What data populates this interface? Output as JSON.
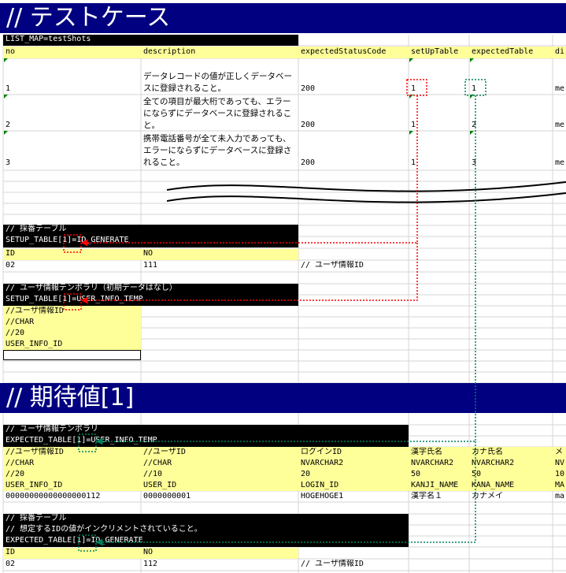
{
  "section1": {
    "title": "// テストケース"
  },
  "list_map": "LIST_MAP=testShots",
  "testcases": {
    "headers": [
      "no",
      "description",
      "expectedStatusCode",
      "setUpTable",
      "expectedTable",
      "di"
    ],
    "rows": [
      {
        "no": "1",
        "desc": "データレコードの値が正しくデータベースに登録されること。",
        "status": "200",
        "setup": "1",
        "expected": "1",
        "di": "me"
      },
      {
        "no": "2",
        "desc": "全ての項目が最大桁であっても、エラーにならずにデータベースに登録されること。",
        "status": "200",
        "setup": "1",
        "expected": "2",
        "di": "me"
      },
      {
        "no": "3",
        "desc": "携帯電話番号が全て未入力であっても、エラーにならずにデータベースに登録されること。",
        "status": "200",
        "setup": "1",
        "expected": "3",
        "di": "me"
      }
    ]
  },
  "setup1": {
    "comment": "// 採番テーブル",
    "name_prefix": "SETUP_TABLE",
    "name_index": "[1]",
    "name_suffix": "=ID_GENERATE",
    "col1_header": "ID",
    "col2_header": "NO",
    "col1_value": "02",
    "col2_value": "111",
    "note": "// ユーザ情報ID"
  },
  "setup2": {
    "comment": "// ユーザ情報テンポラリ（初期データはなし）",
    "name_prefix": "SETUP_TABLE",
    "name_index": "[1]",
    "name_suffix": "=USER_INFO_TEMP",
    "rows": [
      "//ユーザ情報ID",
      "//CHAR",
      "//20",
      "USER_INFO_ID"
    ]
  },
  "section2": {
    "title": "// 期待値[1]"
  },
  "expected1": {
    "comment": "// ユーザ情報テンポラリ",
    "name_prefix": "EXPECTED_TABLE",
    "name_index": "[1]",
    "name_suffix": "=USER_INFO_TEMP",
    "rows": [
      [
        "//ユーザ情報ID",
        "//ユーザID",
        "ログインID",
        "漢字氏名",
        "カナ氏名",
        "メ"
      ],
      [
        "//CHAR",
        "//CHAR",
        "NVARCHAR2",
        "NVARCHAR2",
        "NVARCHAR2",
        "NV"
      ],
      [
        "//20",
        "//10",
        "20",
        "50",
        "50",
        "10"
      ],
      [
        "USER_INFO_ID",
        "USER_ID",
        "LOGIN_ID",
        "KANJI_NAME",
        "KANA_NAME",
        "MA"
      ],
      [
        "00000000000000000112",
        "0000000001",
        "HOGEHOGE1",
        "漢字名１",
        "カナメイ",
        "ma"
      ]
    ]
  },
  "expected2": {
    "comment1": "// 採番テーブル",
    "comment2": "// 想定するIDの値がインクリメントされていること。",
    "name_prefix": "EXPECTED_TABLE",
    "name_index": "[1]",
    "name_suffix": "=ID_GENERATE",
    "col1_header": "ID",
    "col2_header": "NO",
    "col1_value": "02",
    "col2_value": "112",
    "note": "// ユーザ情報ID"
  },
  "colors": {
    "band": "#000080",
    "yellow": "#ffff99",
    "red_arrow": "#ff0000",
    "green_arrow": "#008060"
  }
}
